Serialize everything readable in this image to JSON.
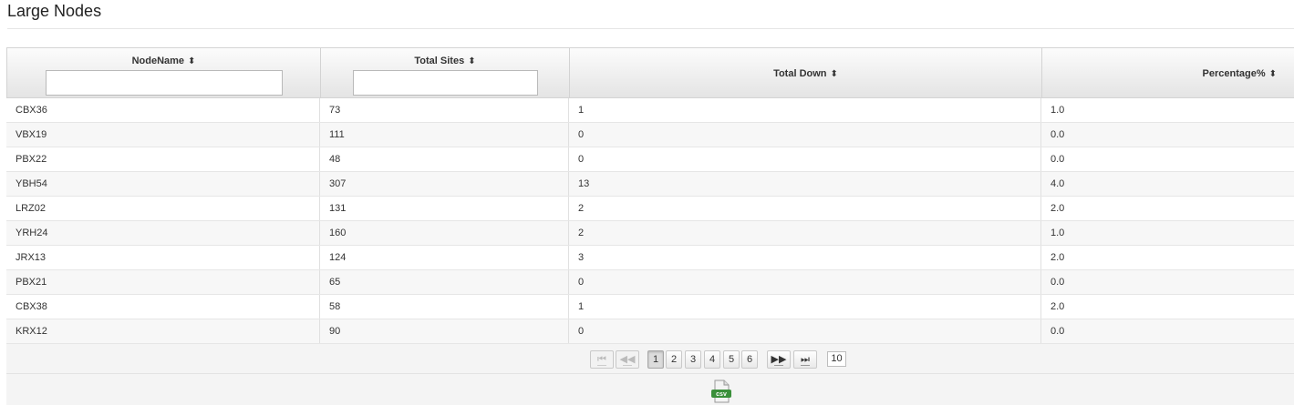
{
  "page": {
    "title": "Large Nodes"
  },
  "table": {
    "columns": [
      {
        "label": "NodeName",
        "sort_icon": "sort-both-icon",
        "filter_value": ""
      },
      {
        "label": "Total Sites",
        "sort_icon": "sort-both-icon",
        "filter_value": ""
      },
      {
        "label": "Total Down",
        "sort_icon": "sort-both-icon"
      },
      {
        "label": "Percentage%",
        "sort_icon": "sort-both-icon"
      }
    ],
    "rows": [
      [
        "CBX36",
        "73",
        "1",
        "1.0"
      ],
      [
        "VBX19",
        "111",
        "0",
        "0.0"
      ],
      [
        "PBX22",
        "48",
        "0",
        "0.0"
      ],
      [
        "YBH54",
        "307",
        "13",
        "4.0"
      ],
      [
        "LRZ02",
        "131",
        "2",
        "2.0"
      ],
      [
        "YRH24",
        "160",
        "2",
        "1.0"
      ],
      [
        "JRX13",
        "124",
        "3",
        "2.0"
      ],
      [
        "PBX21",
        "65",
        "0",
        "0.0"
      ],
      [
        "CBX38",
        "58",
        "1",
        "2.0"
      ],
      [
        "KRX12",
        "90",
        "0",
        "0.0"
      ]
    ]
  },
  "pager": {
    "first_icon": "first-page-icon",
    "prev_icon": "prev-page-icon",
    "next_icon": "next-page-icon",
    "last_icon": "last-page-icon",
    "pages": [
      "1",
      "2",
      "3",
      "4",
      "5",
      "6"
    ],
    "current_page": "1",
    "page_size": "10"
  },
  "export": {
    "csv_label": "csv",
    "icon": "csv-file-icon",
    "accent": "#3a8f3a"
  }
}
